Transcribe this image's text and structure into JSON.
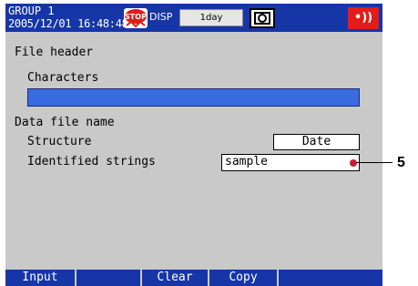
{
  "header": {
    "group": "GROUP 1",
    "datetime": "2005/12/01 16:48:48",
    "disp_label": "DISP",
    "time_span": "1day",
    "stop_icon": "stop-record-icon",
    "camera_icon": "snapshot-icon",
    "alarm_icon": "alarm-indicator-icon",
    "alarm_color": "#e31b1b",
    "accent_color": "#1636a8"
  },
  "file_header": {
    "title": "File header",
    "characters_label": "Characters",
    "characters_value": ""
  },
  "data_file_name": {
    "title": "Data file name",
    "structure_label": "Structure",
    "structure_value": "Date",
    "identified_label": "Identified strings",
    "identified_value": "sample"
  },
  "softkeys": [
    "Input",
    "",
    "Clear",
    "Copy"
  ],
  "callout": {
    "number": "5"
  }
}
